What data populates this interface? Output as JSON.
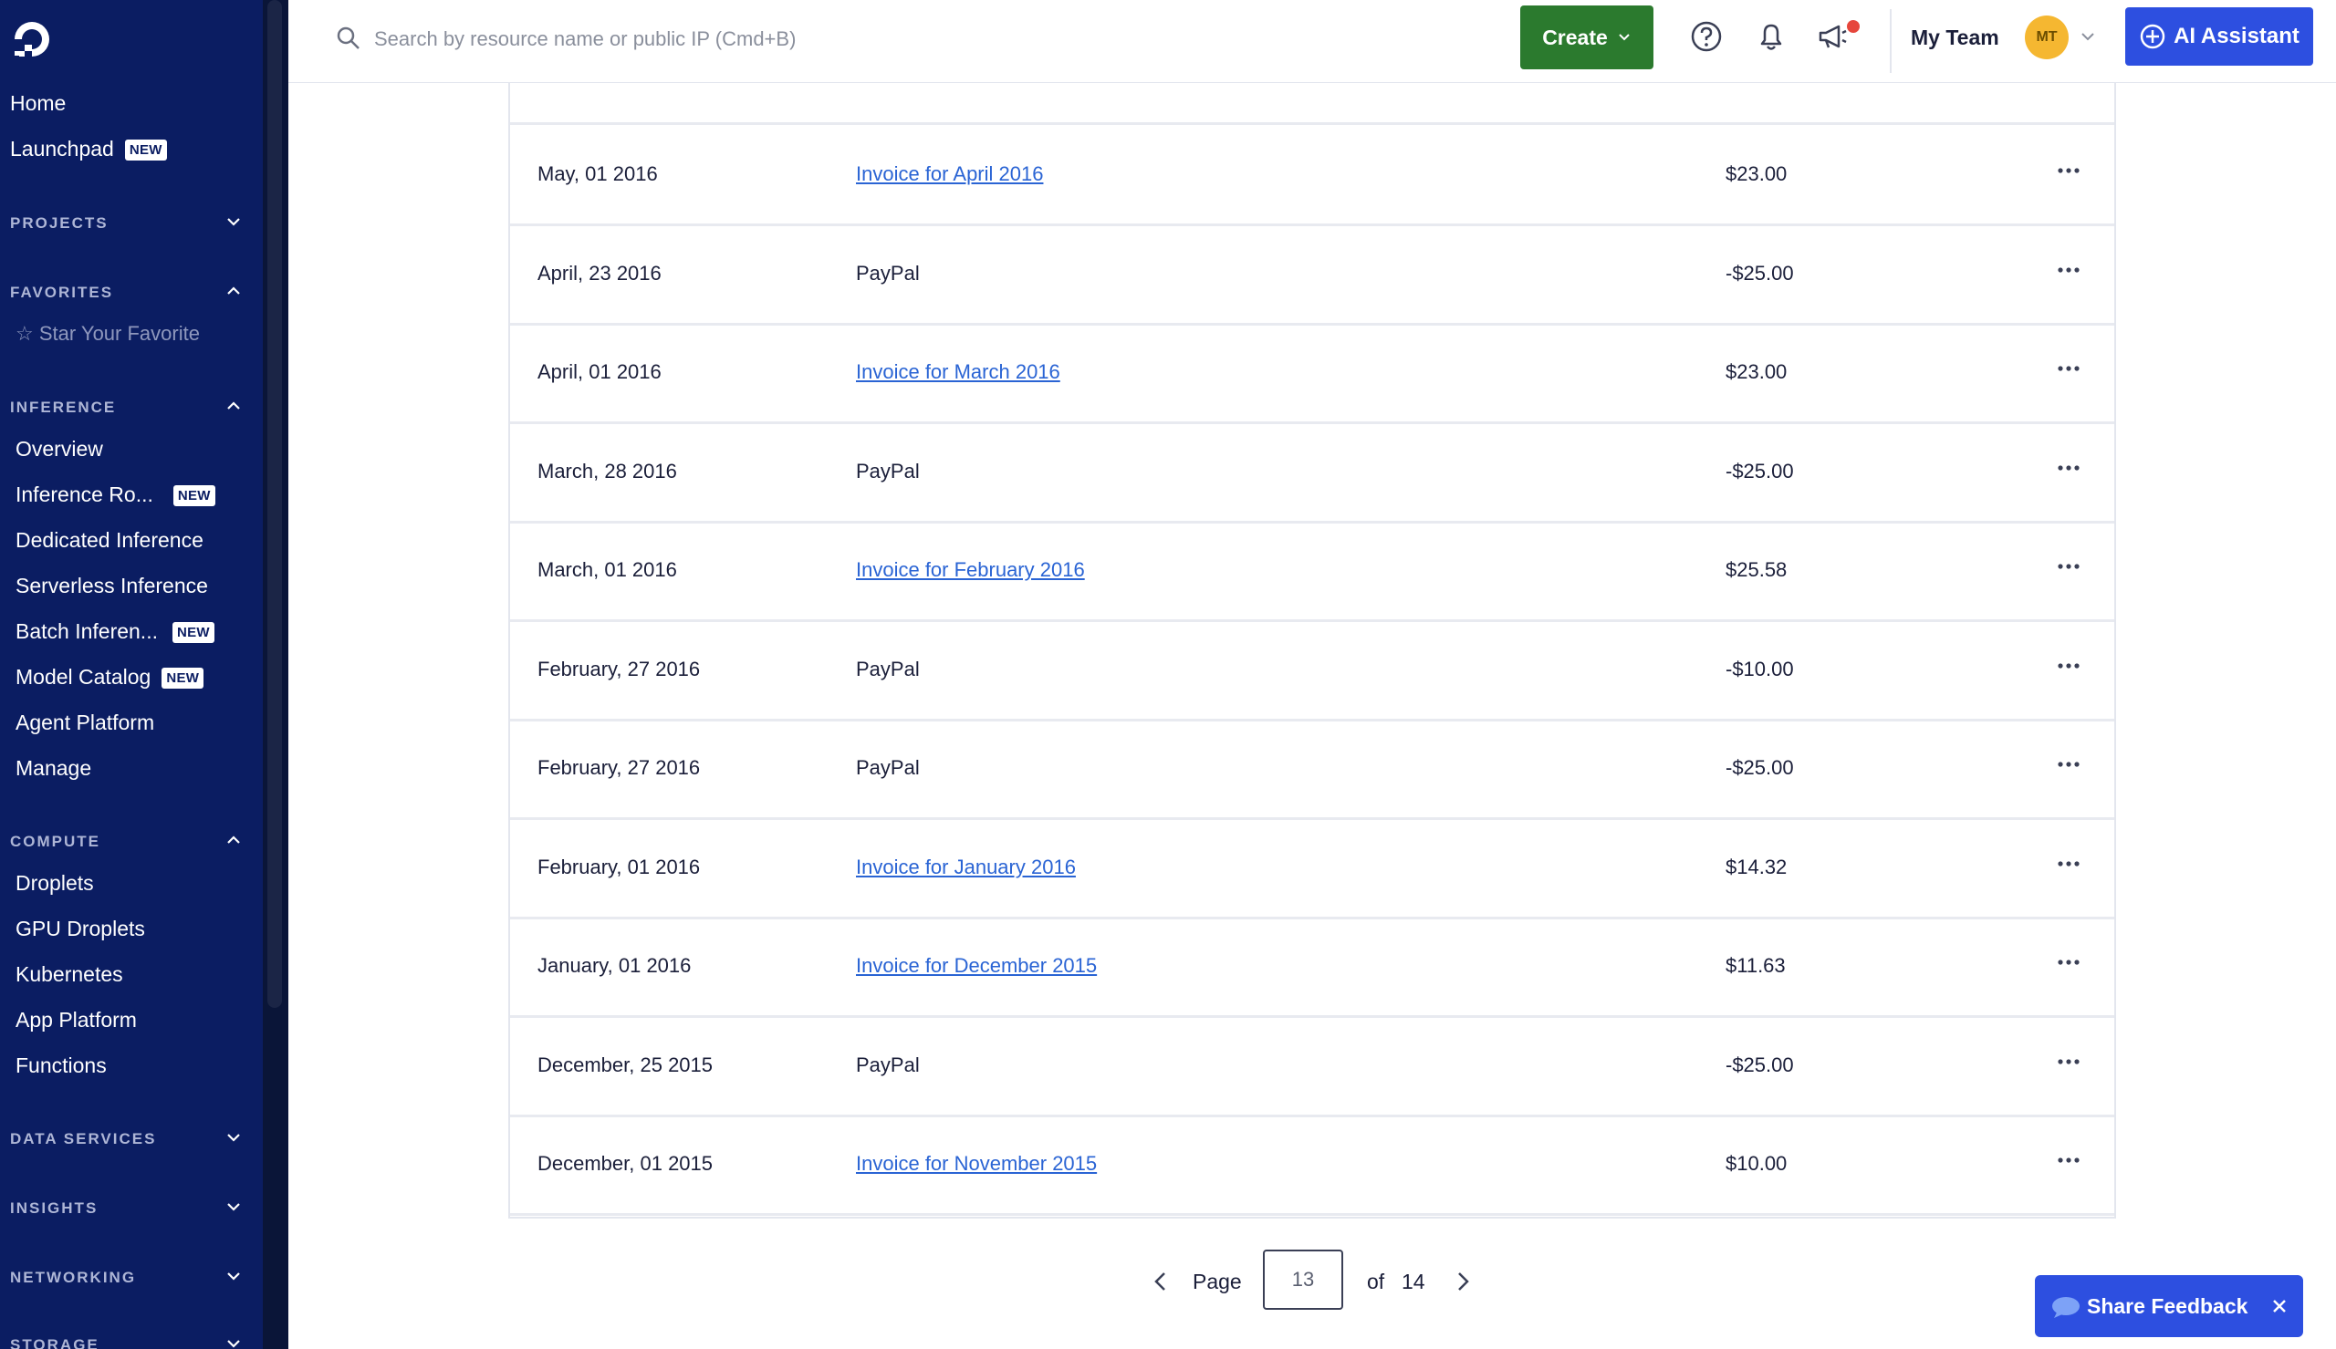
{
  "sidebar": {
    "home": "Home",
    "launchpad": "Launchpad",
    "new_badge": "NEW",
    "sections": {
      "projects": "PROJECTS",
      "favorites": "FAVORITES",
      "inference": "INFERENCE",
      "compute": "COMPUTE",
      "data_services": "DATA SERVICES",
      "insights": "INSIGHTS",
      "networking": "NETWORKING",
      "storage": "STORAGE"
    },
    "star_favorite": "Star Your Favorite",
    "inference_items": [
      "Overview",
      "Inference Ro...",
      "Dedicated Inference",
      "Serverless Inference",
      "Batch Inferen...",
      "Model Catalog",
      "Agent Platform",
      "Manage"
    ],
    "compute_items": [
      "Droplets",
      "GPU Droplets",
      "Kubernetes",
      "App Platform",
      "Functions"
    ]
  },
  "topbar": {
    "search_placeholder": "Search by resource name or public IP (Cmd+B)",
    "create_label": "Create",
    "team_label": "My Team",
    "avatar_initials": "MT",
    "ai_label": "AI Assistant"
  },
  "billing": {
    "rows": [
      {
        "date": "May, 01 2016",
        "description": "Invoice for April 2016",
        "amount": "$23.00",
        "is_link": true
      },
      {
        "date": "April, 23 2016",
        "description": "PayPal",
        "amount": "-$25.00",
        "is_link": false
      },
      {
        "date": "April, 01 2016",
        "description": "Invoice for March 2016",
        "amount": "$23.00",
        "is_link": true
      },
      {
        "date": "March, 28 2016",
        "description": "PayPal",
        "amount": "-$25.00",
        "is_link": false
      },
      {
        "date": "March, 01 2016",
        "description": "Invoice for February 2016",
        "amount": "$25.58",
        "is_link": true
      },
      {
        "date": "February, 27 2016",
        "description": "PayPal",
        "amount": "-$10.00",
        "is_link": false
      },
      {
        "date": "February, 27 2016",
        "description": "PayPal",
        "amount": "-$25.00",
        "is_link": false
      },
      {
        "date": "February, 01 2016",
        "description": "Invoice for January 2016",
        "amount": "$14.32",
        "is_link": true
      },
      {
        "date": "January, 01 2016",
        "description": "Invoice for December 2015",
        "amount": "$11.63",
        "is_link": true
      },
      {
        "date": "December, 25 2015",
        "description": "PayPal",
        "amount": "-$25.00",
        "is_link": false
      },
      {
        "date": "December, 01 2015",
        "description": "Invoice for November 2015",
        "amount": "$10.00",
        "is_link": true
      }
    ]
  },
  "pagination": {
    "page_label": "Page",
    "current": "13",
    "of_label": "of",
    "total": "14"
  },
  "feedback": {
    "label": "Share Feedback"
  },
  "colors": {
    "sidebar_bg": "#0b1d62",
    "create_green": "#2b7a2e",
    "ai_blue": "#2d4fe0",
    "link_blue": "#2a64d4"
  }
}
